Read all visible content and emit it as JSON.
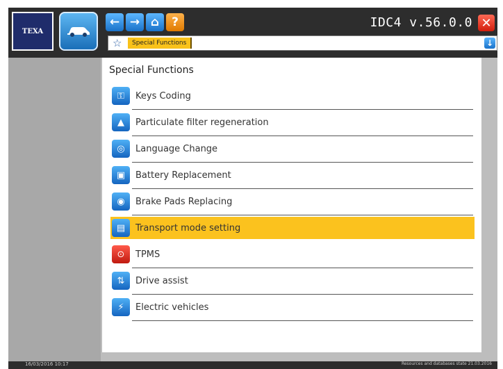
{
  "app": {
    "brand": "TEXA",
    "version": "IDC4 v.56.0.0"
  },
  "icons": {
    "back": "arrow-left",
    "forward": "arrow-right",
    "home": "home",
    "help": "question-mark",
    "close": "close"
  },
  "breadcrumb": {
    "item": "Special Functions"
  },
  "main": {
    "title": "Special Functions",
    "items": [
      {
        "label": "Keys Coding",
        "icon": "key-coding-icon"
      },
      {
        "label": "Particulate filter regeneration",
        "icon": "particulate-filter-icon"
      },
      {
        "label": "Language Change",
        "icon": "language-icon"
      },
      {
        "label": "Battery Replacement",
        "icon": "battery-icon"
      },
      {
        "label": "Brake Pads Replacing",
        "icon": "brake-pads-icon"
      },
      {
        "label": "Transport mode setting",
        "icon": "transport-mode-icon",
        "selected": true
      },
      {
        "label": "TPMS",
        "icon": "tpms-icon"
      },
      {
        "label": "Drive assist",
        "icon": "drive-assist-icon"
      },
      {
        "label": "Electric vehicles",
        "icon": "electric-vehicle-icon"
      }
    ]
  },
  "status": {
    "datetime": "16/03/2016 10:17",
    "right": "Resources and databases state 21.03.2016"
  },
  "colors": {
    "selected": "#fbc21e",
    "accent": "#1a72c9",
    "frame": "#2d2d2d"
  }
}
